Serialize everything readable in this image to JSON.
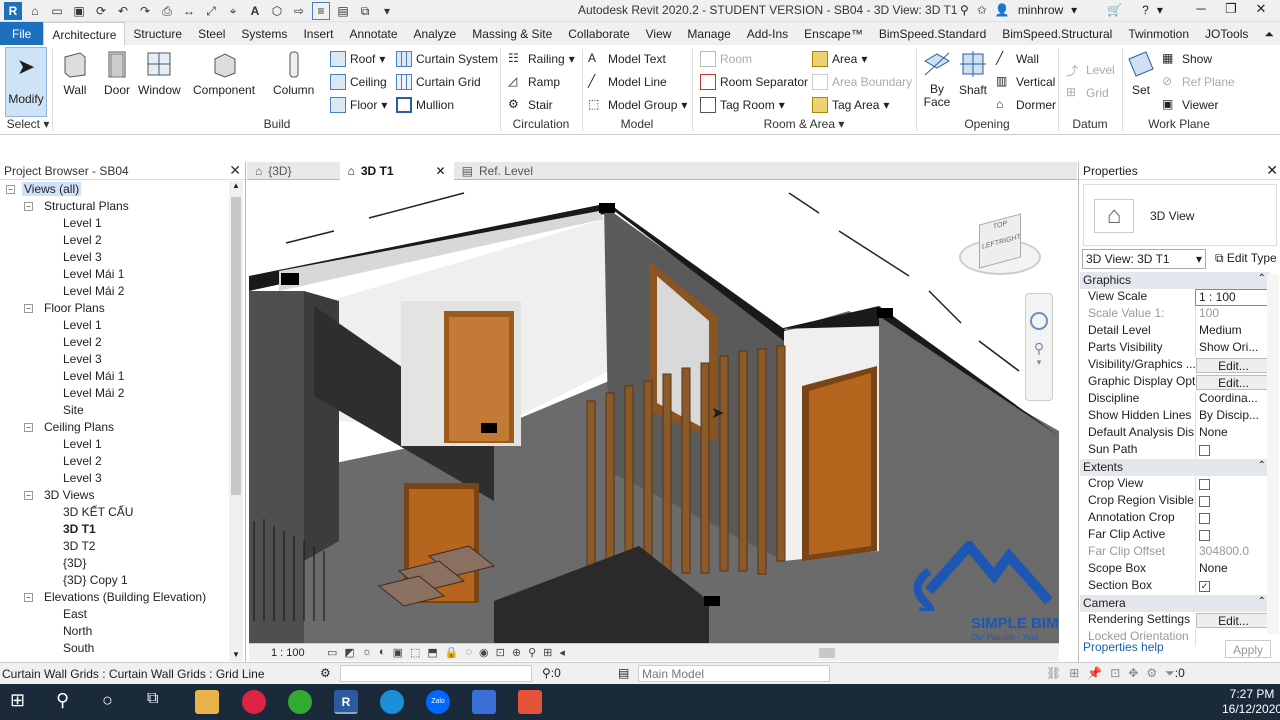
{
  "title": "Autodesk Revit 2020.2 - STUDENT VERSION - SB04 - 3D View: 3D T1",
  "user": "minhrow",
  "tabs": [
    "File",
    "Architecture",
    "Structure",
    "Steel",
    "Systems",
    "Insert",
    "Annotate",
    "Analyze",
    "Massing & Site",
    "Collaborate",
    "View",
    "Manage",
    "Add-Ins",
    "Enscape™",
    "BimSpeed.Standard",
    "BimSpeed.Structural",
    "Twinmotion",
    "JOTools"
  ],
  "ribbon": {
    "modify": "Modify",
    "select": "Select",
    "build": {
      "wall": "Wall",
      "door": "Door",
      "window": "Window",
      "component": "Component",
      "column": "Column",
      "roof": "Roof",
      "ceiling": "Ceiling",
      "floor": "Floor",
      "curtain_system": "Curtain System",
      "curtain_grid": "Curtain Grid",
      "mullion": "Mullion",
      "label": "Build"
    },
    "circulation": {
      "railing": "Railing",
      "ramp": "Ramp",
      "stair": "Stair",
      "label": "Circulation"
    },
    "model": {
      "text": "Model Text",
      "line": "Model Line",
      "group": "Model Group",
      "label": "Model"
    },
    "room": {
      "room": "Room",
      "separator": "Room Separator",
      "tag_room": "Tag Room",
      "area": "Area",
      "area_boundary": "Area Boundary",
      "tag_area": "Tag Area",
      "label": "Room & Area"
    },
    "opening": {
      "byface": "By Face",
      "shaft": "Shaft",
      "wall": "Wall",
      "vertical": "Vertical",
      "dormer": "Dormer",
      "label": "Opening"
    },
    "datum": {
      "level": "Level",
      "grid": "Grid",
      "label": "Datum"
    },
    "workplane": {
      "set": "Set",
      "show": "Show",
      "ref_plane": "Ref Plane",
      "viewer": "Viewer",
      "label": "Work Plane"
    }
  },
  "browser": {
    "title": "Project Browser - SB04",
    "items": [
      {
        "t": "Views (all)",
        "lvl": 0,
        "tog": "-"
      },
      {
        "t": "Structural Plans",
        "lvl": 1,
        "tog": "-"
      },
      {
        "t": "Level 1",
        "lvl": 2
      },
      {
        "t": "Level 2",
        "lvl": 2
      },
      {
        "t": "Level 3",
        "lvl": 2
      },
      {
        "t": "Level Mái 1",
        "lvl": 2
      },
      {
        "t": "Level Mái 2",
        "lvl": 2
      },
      {
        "t": "Floor Plans",
        "lvl": 1,
        "tog": "-"
      },
      {
        "t": "Level 1",
        "lvl": 2
      },
      {
        "t": "Level 2",
        "lvl": 2
      },
      {
        "t": "Level 3",
        "lvl": 2
      },
      {
        "t": "Level Mái 1",
        "lvl": 2
      },
      {
        "t": "Level Mái 2",
        "lvl": 2
      },
      {
        "t": "Site",
        "lvl": 2
      },
      {
        "t": "Ceiling Plans",
        "lvl": 1,
        "tog": "-"
      },
      {
        "t": "Level 1",
        "lvl": 2
      },
      {
        "t": "Level 2",
        "lvl": 2
      },
      {
        "t": "Level 3",
        "lvl": 2
      },
      {
        "t": "3D Views",
        "lvl": 1,
        "tog": "-"
      },
      {
        "t": "3D KẾT CẤU",
        "lvl": 2
      },
      {
        "t": "3D T1",
        "lvl": 2,
        "sel": true
      },
      {
        "t": "3D T2",
        "lvl": 2
      },
      {
        "t": "{3D}",
        "lvl": 2
      },
      {
        "t": "{3D} Copy 1",
        "lvl": 2
      },
      {
        "t": "Elevations (Building Elevation)",
        "lvl": 1,
        "tog": "-"
      },
      {
        "t": "East",
        "lvl": 2
      },
      {
        "t": "North",
        "lvl": 2
      },
      {
        "t": "South",
        "lvl": 2
      }
    ]
  },
  "view_tabs": [
    "{3D}",
    "3D T1",
    "Ref. Level"
  ],
  "view_scale": "1 : 100",
  "viewcube": {
    "top": "TOP",
    "left": "LEFT",
    "right": "RIGHT"
  },
  "watermark": {
    "name": "SIMPLE BIM",
    "tagline": "Our Passion - Your Comfort"
  },
  "props": {
    "title": "Properties",
    "type": "3D View",
    "selector": "3D View: 3D T1",
    "edit_type": "Edit Type",
    "graphics": "Graphics",
    "extents": "Extents",
    "camera": "Camera",
    "rows_g": [
      {
        "k": "View Scale",
        "v": "1 : 100",
        "box": true
      },
      {
        "k": "Scale Value    1:",
        "v": "100",
        "dis": true
      },
      {
        "k": "Detail Level",
        "v": "Medium"
      },
      {
        "k": "Parts Visibility",
        "v": "Show Ori..."
      },
      {
        "k": "Visibility/Graphics ...",
        "v": "Edit...",
        "btn": true
      },
      {
        "k": "Graphic Display Opt...",
        "v": "Edit...",
        "btn": true
      },
      {
        "k": "Discipline",
        "v": "Coordina..."
      },
      {
        "k": "Show Hidden Lines",
        "v": "By Discip..."
      },
      {
        "k": "Default Analysis Dis...",
        "v": "None"
      },
      {
        "k": "Sun Path",
        "v": "",
        "chk": false
      }
    ],
    "rows_e": [
      {
        "k": "Crop View",
        "v": "",
        "chk": false
      },
      {
        "k": "Crop Region Visible",
        "v": "",
        "chk": false
      },
      {
        "k": "Annotation Crop",
        "v": "",
        "chk": false
      },
      {
        "k": "Far Clip Active",
        "v": "",
        "chk": false
      },
      {
        "k": "Far Clip Offset",
        "v": "304800.0",
        "dis": true
      },
      {
        "k": "Scope Box",
        "v": "None"
      },
      {
        "k": "Section Box",
        "v": "",
        "chk": true
      }
    ],
    "rows_c": [
      {
        "k": "Rendering Settings",
        "v": "Edit...",
        "btn": true
      },
      {
        "k": "Locked Orientation",
        "v": "",
        "dis": true
      }
    ],
    "help": "Properties help",
    "apply": "Apply"
  },
  "status": {
    "text": "Curtain Wall Grids : Curtain Wall Grids : Grid Line",
    "counter": ":0",
    "model": "Main Model",
    "filter": ":0"
  },
  "clock": {
    "time": "7:27 PM",
    "date": "16/12/2020"
  },
  "colors": {
    "file_tab": "#1f6fbf",
    "taskbar": "#1b2a3a",
    "wood": "#b5651d",
    "wall": "#5a5a5a"
  }
}
